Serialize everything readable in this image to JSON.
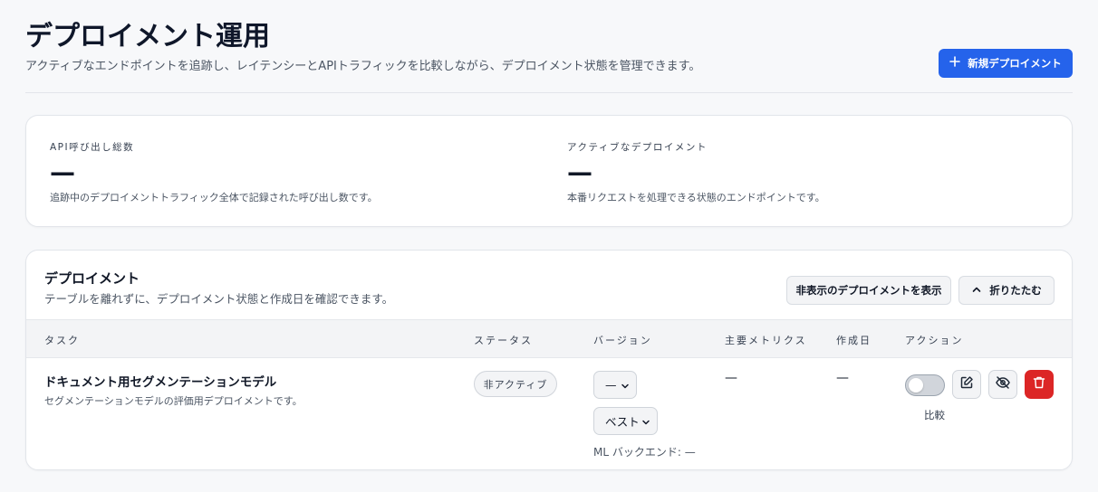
{
  "header": {
    "title": "デプロイメント運用",
    "subtitle": "アクティブなエンドポイントを追跡し、レイテンシーとAPIトラフィックを比較しながら、デプロイメント状態を管理できます。",
    "new_button_label": "新規デプロイメント",
    "new_button_icon": "plus-icon"
  },
  "stats": [
    {
      "label": "API呼び出し総数",
      "value": "—",
      "description": "追跡中のデプロイメントトラフィック全体で記録された呼び出し数です。"
    },
    {
      "label": "アクティブなデプロイメント",
      "value": "—",
      "description": "本番リクエストを処理できる状態のエンドポイントです。"
    }
  ],
  "deployments": {
    "title": "デプロイメント",
    "subtitle": "テーブルを離れずに、デプロイメント状態と作成日を確認できます。",
    "show_hidden_label": "非表示のデプロイメントを表示",
    "collapse_label": "折りたたむ",
    "columns": [
      "タスク",
      "ステータス",
      "バージョン",
      "主要メトリクス",
      "作成日",
      "アクション"
    ],
    "rows": [
      {
        "task_title": "ドキュメント用セグメンテーションモデル",
        "task_desc": "セグメンテーションモデルの評価用デプロイメントです。",
        "status": "非アクティブ",
        "version": "—",
        "selection": "ベスト",
        "ml_backend": "ML バックエンド: —",
        "metric": "—",
        "created": "—",
        "compare_label": "比較",
        "compare_on": false
      }
    ]
  },
  "colors": {
    "primary": "#2563eb",
    "danger": "#dc2626",
    "background": "#f7f8fa",
    "card": "#ffffff"
  }
}
